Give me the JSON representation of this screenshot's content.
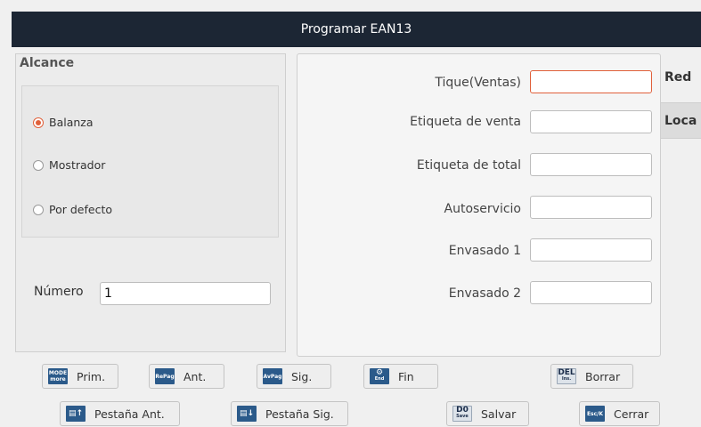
{
  "window": {
    "title": "Programar EAN13"
  },
  "scope": {
    "title": "Alcance",
    "options": [
      {
        "label": "Balanza",
        "selected": true
      },
      {
        "label": "Mostrador",
        "selected": false
      },
      {
        "label": "Por defecto",
        "selected": false
      }
    ],
    "number_label": "Número",
    "number_value": "1"
  },
  "fields": [
    {
      "label": "Tique(Ventas)",
      "value": ""
    },
    {
      "label": "Etiqueta de venta",
      "value": ""
    },
    {
      "label": "Etiqueta de total",
      "value": ""
    },
    {
      "label": "Autoservicio",
      "value": ""
    },
    {
      "label": "Envasado 1",
      "value": ""
    },
    {
      "label": "Envasado 2",
      "value": ""
    }
  ],
  "side_tabs": [
    {
      "label": "Red",
      "selected": false
    },
    {
      "label": "Loca",
      "selected": true
    }
  ],
  "buttons": {
    "first": {
      "label": "Prim.",
      "icon_text": "MODE",
      "icon_sub": "more"
    },
    "prev": {
      "label": "Ant.",
      "icon_text": "RePag"
    },
    "next": {
      "label": "Sig.",
      "icon_text": "AvPag"
    },
    "end": {
      "label": "Fin",
      "icon_text": "⚙",
      "icon_sub": "End"
    },
    "delete": {
      "label": "Borrar",
      "icon_text": "DEL",
      "icon_sub": "Ins."
    },
    "prev_tab": {
      "label": "Pestaña Ant.",
      "icon_text": "▤↑"
    },
    "next_tab": {
      "label": "Pestaña Sig.",
      "icon_text": "▤↓"
    },
    "save": {
      "label": "Salvar",
      "icon_text": "D0",
      "icon_sub": "Save"
    },
    "close": {
      "label": "Cerrar",
      "icon_text": "Esc/K"
    }
  }
}
